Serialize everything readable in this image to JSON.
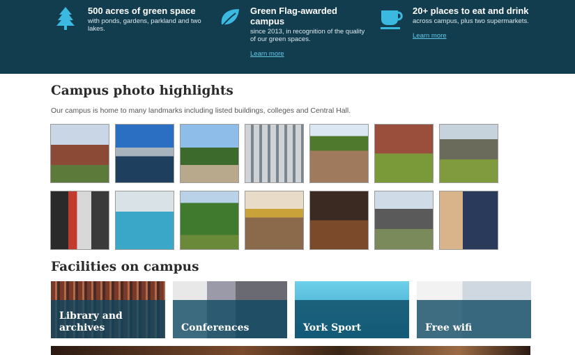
{
  "features": [
    {
      "icon": "tree-icon",
      "title": "500 acres of green space",
      "desc": "with ponds, gardens, parkland and two lakes.",
      "link": ""
    },
    {
      "icon": "leaf-icon",
      "title": "Green Flag-awarded campus",
      "desc": "since 2013, in recognition of the quality of our green spaces.",
      "link": "Learn more"
    },
    {
      "icon": "coffee-cup-icon",
      "title": "20+ places to eat and drink",
      "desc": "across campus, plus two supermarkets.",
      "link": "Learn more"
    }
  ],
  "photos": {
    "title": "Campus photo highlights",
    "intro": "Our campus is home to many landmarks including listed buildings, colleges and Central Hall."
  },
  "facilities": {
    "title": "Facilities on campus",
    "items": [
      {
        "label": "Library and archives"
      },
      {
        "label": "Conferences"
      },
      {
        "label": "York Sport"
      },
      {
        "label": "Free wifi"
      }
    ]
  },
  "colors": {
    "band": "#123d4f",
    "link": "#63c7e8",
    "caption": "#0c4862"
  }
}
